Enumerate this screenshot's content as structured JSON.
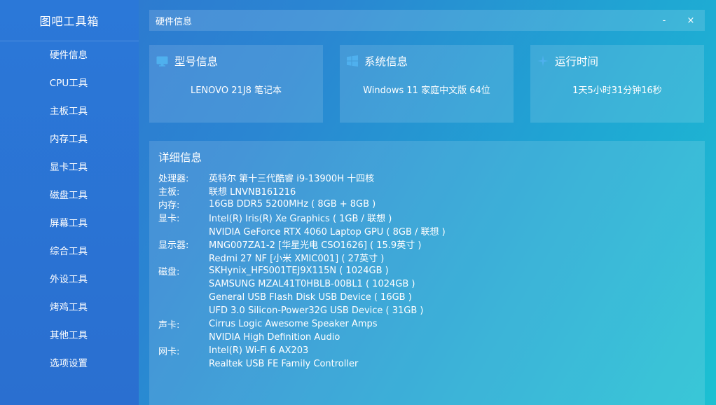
{
  "app": {
    "title": "图吧工具箱"
  },
  "sidebar": {
    "items": [
      {
        "label": "硬件信息"
      },
      {
        "label": "CPU工具"
      },
      {
        "label": "主板工具"
      },
      {
        "label": "内存工具"
      },
      {
        "label": "显卡工具"
      },
      {
        "label": "磁盘工具"
      },
      {
        "label": "屏幕工具"
      },
      {
        "label": "综合工具"
      },
      {
        "label": "外设工具"
      },
      {
        "label": "烤鸡工具"
      },
      {
        "label": "其他工具"
      },
      {
        "label": "选项设置"
      }
    ]
  },
  "window": {
    "title": "硬件信息",
    "minimize": "-",
    "close": "×"
  },
  "cards": [
    {
      "title": "型号信息",
      "value": "LENOVO 21J8 笔记本",
      "icon": "monitor-icon"
    },
    {
      "title": "系统信息",
      "value": "Windows 11 家庭中文版 64位",
      "icon": "windows-icon"
    },
    {
      "title": "运行时间",
      "value": "1天5小时31分钟16秒",
      "icon": "sparkle-icon"
    }
  ],
  "detail": {
    "title": "详细信息",
    "rows": [
      {
        "key": "处理器:",
        "value": "英特尔 第十三代酷睿 i9-13900H 十四核"
      },
      {
        "key": "主板:",
        "value": "联想 LNVNB161216"
      },
      {
        "key": "内存:",
        "value": "16GB DDR5 5200MHz ( 8GB + 8GB )"
      },
      {
        "key": "显卡:",
        "value": "Intel(R) Iris(R) Xe Graphics ( 1GB / 联想 )"
      },
      {
        "key": "",
        "value": "NVIDIA GeForce RTX 4060 Laptop GPU ( 8GB / 联想 )"
      },
      {
        "key": "显示器:",
        "value": "MNG007ZA1-2 [华星光电 CSO1626] ( 15.9英寸 )"
      },
      {
        "key": "",
        "value": "Redmi 27 NF [小米 XMIC001] ( 27英寸 )"
      },
      {
        "key": "磁盘:",
        "value": "SKHynix_HFS001TEJ9X115N ( 1024GB )"
      },
      {
        "key": "",
        "value": "SAMSUNG MZAL41T0HBLB-00BL1 ( 1024GB )"
      },
      {
        "key": "",
        "value": "General USB Flash Disk USB Device ( 16GB )"
      },
      {
        "key": "",
        "value": "UFD 3.0 Silicon-Power32G USB Device ( 31GB )"
      },
      {
        "key": "声卡:",
        "value": "Cirrus Logic Awesome Speaker Amps"
      },
      {
        "key": "",
        "value": "NVIDIA High Definition Audio"
      },
      {
        "key": "网卡:",
        "value": "Intel(R) Wi-Fi 6 AX203"
      },
      {
        "key": "",
        "value": "Realtek USB FE Family Controller"
      }
    ]
  },
  "colors": {
    "accent": "#2b78d8",
    "gradient_end": "#1cc0d2",
    "icon": "#4fb0ee"
  }
}
